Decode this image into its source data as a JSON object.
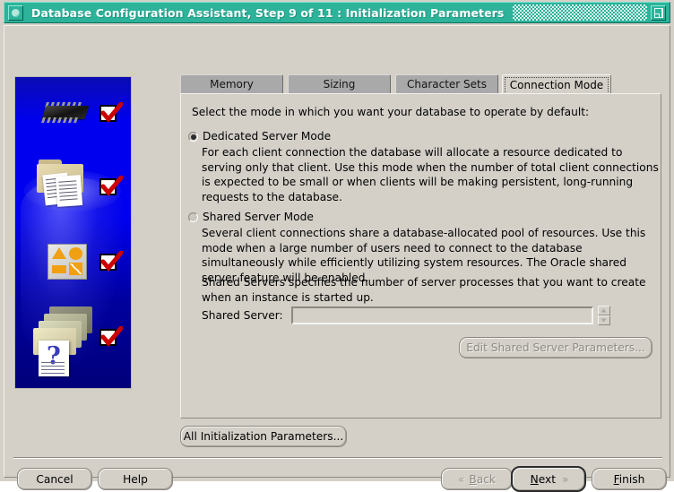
{
  "window": {
    "title": "Database Configuration Assistant, Step 9 of 11 : Initialization Parameters",
    "menu_icon": "window-menu-icon",
    "maximize_icon": "maximize-icon",
    "title_bar_color": "#2cb39a",
    "background_color": "#d4d0c8"
  },
  "banner": {
    "name": "oracle-wizard-illustration",
    "background_color": "#0000ee",
    "icons": [
      "chip-icon",
      "folder-documents-icon",
      "shapes-palette-icon",
      "folder-stack-question-icon"
    ],
    "checkmarks": 4,
    "checkmark_color": "#cc0000"
  },
  "tabs": [
    {
      "label": "Memory",
      "name": "tab-memory",
      "selected": false
    },
    {
      "label": "Sizing",
      "name": "tab-sizing",
      "selected": false
    },
    {
      "label": "Character Sets",
      "name": "tab-character-sets",
      "selected": false
    },
    {
      "label": "Connection Mode",
      "name": "tab-connection-mode",
      "selected": true
    }
  ],
  "panel": {
    "intro": "Select the mode in which you want your database to operate by default:",
    "options": [
      {
        "name": "dedicated-server-mode",
        "label": "Dedicated Server Mode",
        "selected": true,
        "description": "For each client connection the database will allocate a resource dedicated to serving only that client.  Use this mode when the number of total client connections is expected to be small or when clients will be making persistent, long-running requests to the database."
      },
      {
        "name": "shared-server-mode",
        "label": "Shared Server Mode",
        "selected": false,
        "description": "Several client connections share a database-allocated pool of resources.  Use this mode when a large number of users need to connect to the database simultaneously while efficiently utilizing system resources.  The Oracle shared server feature will be enabled."
      }
    ],
    "note": "Shared Servers specifies the number of server processes that you want to create when an instance is started up.",
    "shared_server_field": {
      "label": "Shared Server:",
      "value": "",
      "placeholder": "",
      "enabled": false
    },
    "spinner": {
      "up_icon": "spinner-up-icon",
      "down_icon": "spinner-down-icon"
    },
    "edit_shared_button": {
      "label": "Edit Shared Server Parameters...",
      "enabled": false
    }
  },
  "all_parameters_button": {
    "label": "All Initialization Parameters..."
  },
  "footer": {
    "cancel": {
      "label": "Cancel"
    },
    "help": {
      "label": "Help"
    },
    "back": {
      "label": "Back",
      "mnemonic": "B",
      "arrow_icon": "chevron-left-icon",
      "enabled": false
    },
    "next": {
      "label": "Next",
      "mnemonic": "N",
      "arrow_icon": "chevron-right-icon",
      "focused": true
    },
    "finish": {
      "label": "Finish",
      "mnemonic": "F"
    }
  }
}
